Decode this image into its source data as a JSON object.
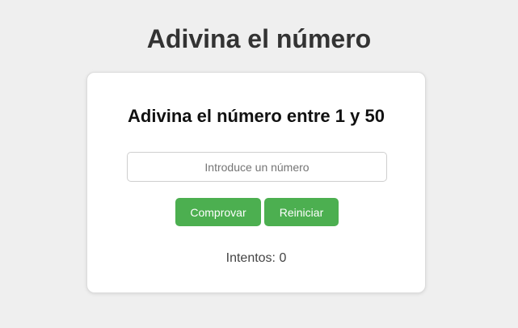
{
  "page": {
    "title": "Adivina el número"
  },
  "card": {
    "heading": "Adivina el número entre 1 y 50",
    "input": {
      "value": "",
      "placeholder": "Introduce un número"
    },
    "buttons": {
      "check_label": "Comprovar",
      "reset_label": "Reiniciar"
    },
    "attempts": {
      "label": "Intentos:",
      "count": "0"
    }
  },
  "colors": {
    "background": "#efefef",
    "card": "#ffffff",
    "button": "#4caf50",
    "button_text": "#ffffff"
  }
}
